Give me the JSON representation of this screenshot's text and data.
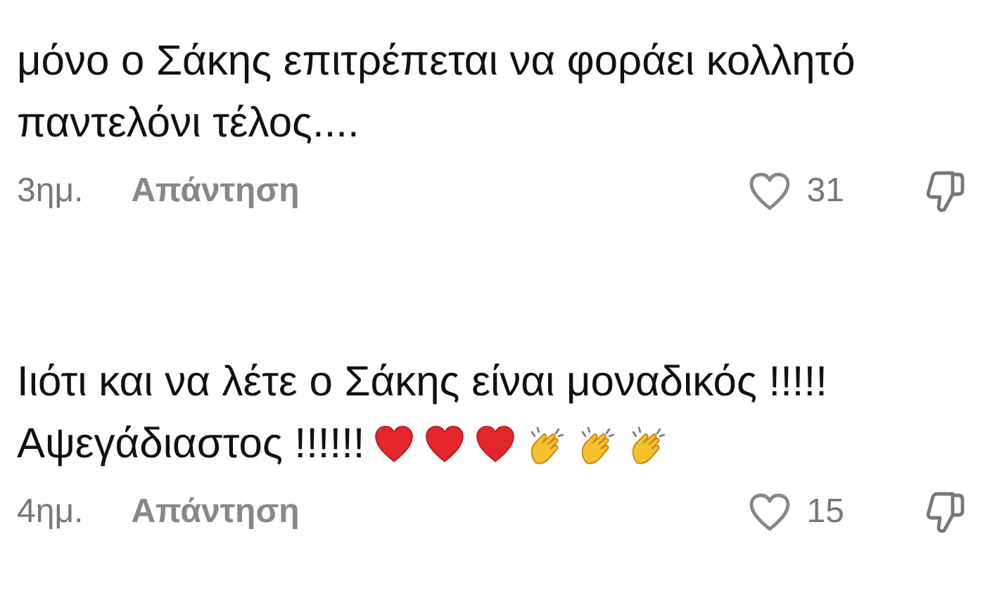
{
  "comments": [
    {
      "lines": [
        "μόνο ο Σάκης επιτρέπεται να φοράει κολλητό",
        "παντελόνι τέλος...."
      ],
      "time": "3ημ.",
      "reply": "Απάντηση",
      "likes": "31",
      "liked": false
    },
    {
      "lines": [
        "Ιιότι και να λέτε ο Σάκης είναι μοναδικός !!!!!",
        "Αψεγάδιαστος !!!!!!"
      ],
      "emojis": [
        {
          "kind": "heart"
        },
        {
          "kind": "heart"
        },
        {
          "kind": "heart"
        },
        {
          "kind": "clap"
        },
        {
          "kind": "clap"
        },
        {
          "kind": "clap"
        }
      ],
      "time": "4ημ.",
      "reply": "Απάντηση",
      "likes": "15",
      "liked": false
    }
  ]
}
